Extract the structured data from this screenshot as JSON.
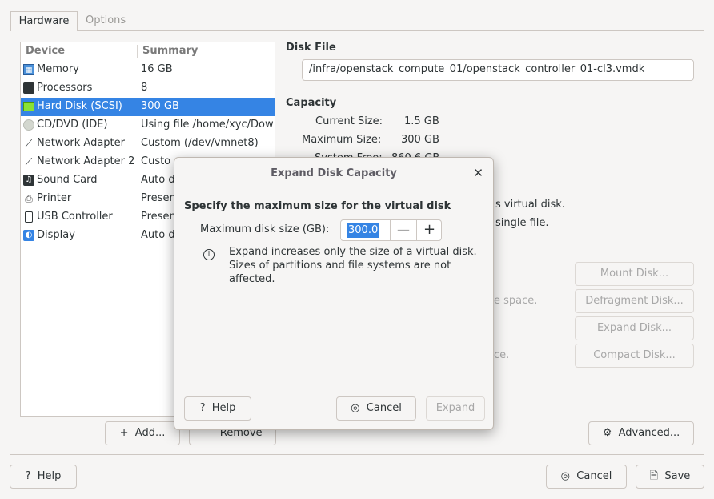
{
  "tabs": [
    {
      "label": "Hardware",
      "active": true
    },
    {
      "label": "Options",
      "active": false
    }
  ],
  "device_list": {
    "headers": {
      "device": "Device",
      "summary": "Summary"
    },
    "items": [
      {
        "name": "Memory",
        "summary": "16 GB",
        "icon": "memory-icon"
      },
      {
        "name": "Processors",
        "summary": "8",
        "icon": "processor-icon"
      },
      {
        "name": "Hard Disk (SCSI)",
        "summary": "300 GB",
        "icon": "hard-disk-icon",
        "selected": true
      },
      {
        "name": "CD/DVD (IDE)",
        "summary": "Using file /home/xyc/Dow",
        "icon": "cd-dvd-icon"
      },
      {
        "name": "Network Adapter",
        "summary": "Custom (/dev/vmnet8)",
        "icon": "network-icon"
      },
      {
        "name": "Network Adapter 2",
        "summary": "Custo",
        "icon": "network-icon"
      },
      {
        "name": "Sound Card",
        "summary": "Auto d",
        "icon": "sound-card-icon"
      },
      {
        "name": "Printer",
        "summary": "Presen",
        "icon": "printer-icon"
      },
      {
        "name": "USB Controller",
        "summary": "Presen",
        "icon": "usb-icon"
      },
      {
        "name": "Display",
        "summary": "Auto d",
        "icon": "display-icon"
      }
    ]
  },
  "list_buttons": {
    "add": "Add...",
    "remove": "Remove"
  },
  "disk_file": {
    "heading": "Disk File",
    "path": "/infra/openstack_compute_01/openstack_controller_01-cl3.vmdk"
  },
  "capacity": {
    "heading": "Capacity",
    "current_label": "Current Size:",
    "current_value": "1.5 GB",
    "max_label": "Maximum Size:",
    "max_value": "300 GB",
    "free_label": "System Free:",
    "free_value": "860.6 GB"
  },
  "bg_texts": {
    "line1": "s virtual disk.",
    "line2": "single file.",
    "line3": "e space.",
    "line4": "ce."
  },
  "utility_buttons": {
    "mount": "Mount Disk...",
    "defrag": "Defragment Disk...",
    "expand": "Expand Disk...",
    "compact": "Compact Disk..."
  },
  "advanced_label": "Advanced...",
  "footer": {
    "help": "Help",
    "cancel": "Cancel",
    "save": "Save"
  },
  "dialog": {
    "title": "Expand Disk Capacity",
    "heading": "Specify the maximum size for the virtual disk",
    "size_label": "Maximum disk size (GB):",
    "size_value": "300.0",
    "info_line1": "Expand increases only the size of a virtual disk.",
    "info_line2": "Sizes of partitions and file systems are not",
    "info_line3": "affected.",
    "help": "Help",
    "cancel": "Cancel",
    "expand": "Expand"
  },
  "colors": {
    "accent": "#3584e4",
    "background": "#f6f5f4"
  }
}
